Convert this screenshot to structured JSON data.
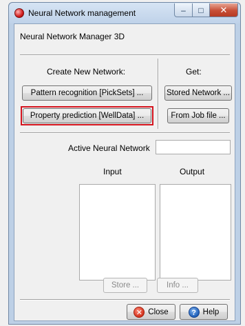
{
  "window": {
    "title": "Neural Network management",
    "controls": {
      "minimize": "–",
      "maximize": "□",
      "close": "✕"
    }
  },
  "header": {
    "label": "Neural Network Manager 3D"
  },
  "create": {
    "label": "Create New Network:",
    "pattern_button": "Pattern recognition [PickSets] ...",
    "property_button": "Property prediction [WellData] ..."
  },
  "get": {
    "label": "Get:",
    "stored_button": "Stored Network ...",
    "jobfile_button": "From Job file ..."
  },
  "active": {
    "label": "Active Neural Network",
    "value": ""
  },
  "lists": {
    "input_label": "Input",
    "output_label": "Output"
  },
  "actions": {
    "store_button": "Store ...",
    "info_button": "Info ..."
  },
  "footer": {
    "close_button": "Close",
    "help_button": "Help",
    "close_icon": "x-icon",
    "help_icon": "question-icon"
  },
  "colors": {
    "highlight": "#d3121c",
    "titlebar": "#c8d9ee",
    "close_button": "#c74e36"
  }
}
